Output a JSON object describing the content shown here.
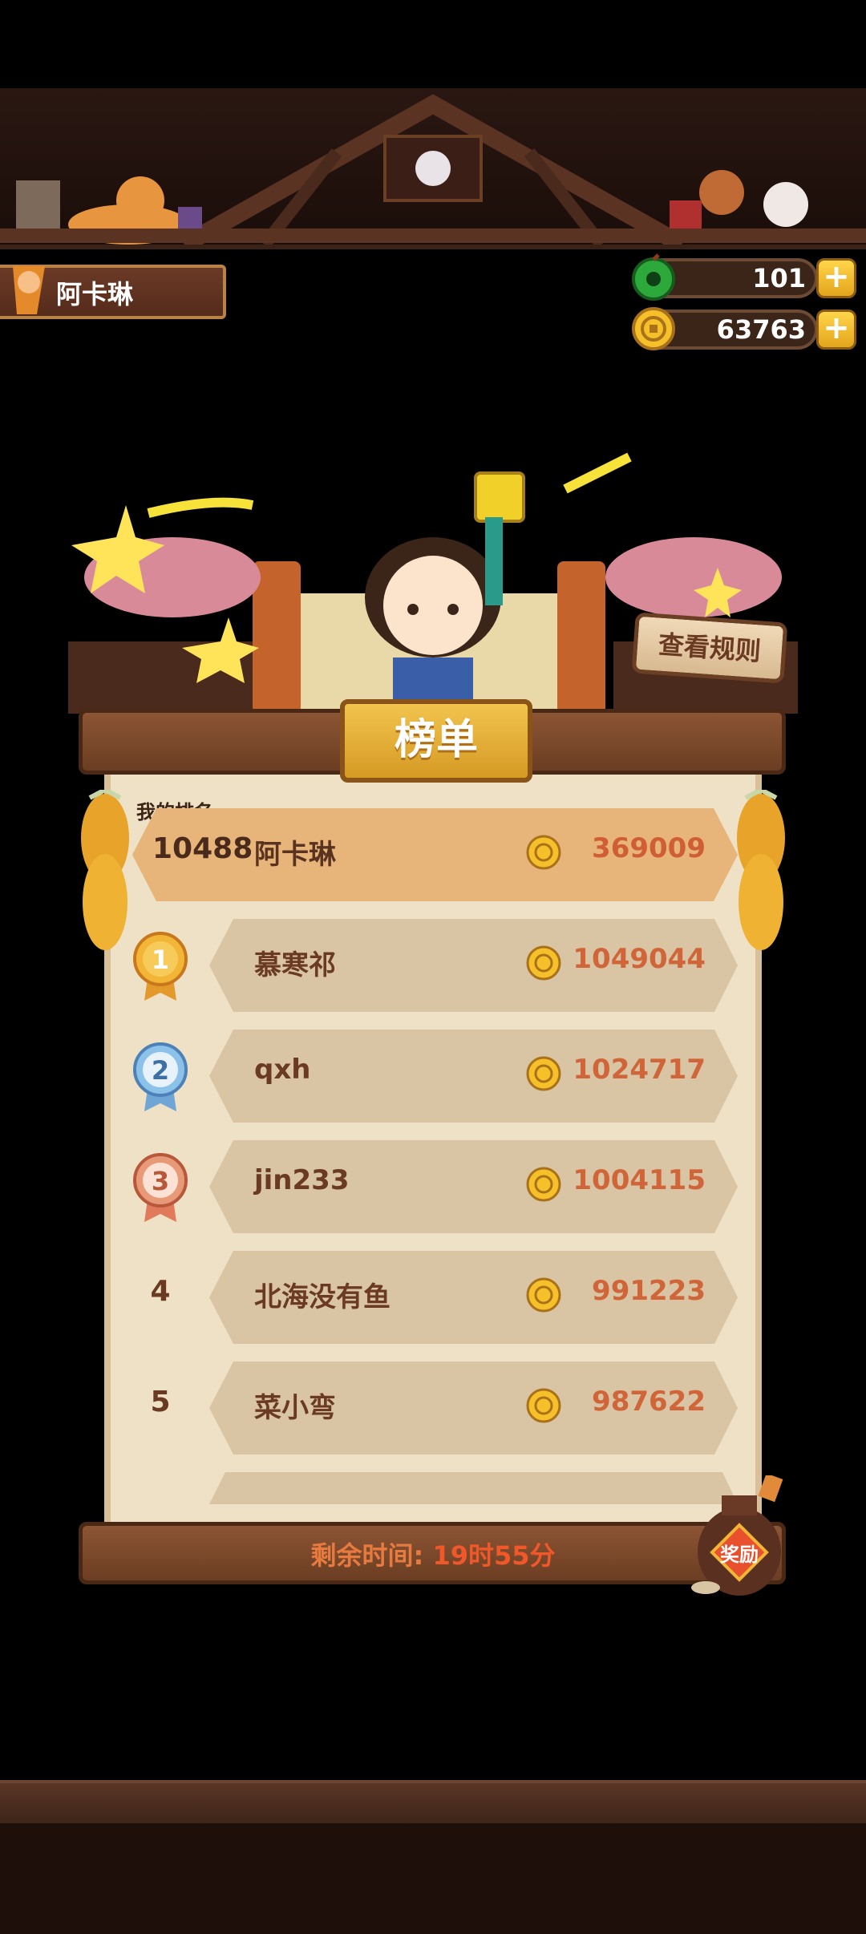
{
  "player": {
    "name": "阿卡琳"
  },
  "currency": {
    "gems": "101",
    "coins": "63763"
  },
  "rules_button": "查看规则",
  "board": {
    "title": "榜单",
    "my_rank_label": "我的排名",
    "my_rank": {
      "rank": "10488",
      "name": "阿卡琳",
      "score": "369009"
    },
    "entries": [
      {
        "rank": "1",
        "name": "慕寒祁",
        "score": "1049044",
        "medal": "gold"
      },
      {
        "rank": "2",
        "name": "qxh",
        "score": "1024717",
        "medal": "silver"
      },
      {
        "rank": "3",
        "name": "jin233",
        "score": "1004115",
        "medal": "bronze"
      },
      {
        "rank": "4",
        "name": "北海没有鱼",
        "score": "991223"
      },
      {
        "rank": "5",
        "name": "菜小弯",
        "score": "987622"
      }
    ],
    "timer_label": "剩余时间: ",
    "timer_value": "19时55分",
    "reward_label": "奖励"
  },
  "colors": {
    "score": "#d0653a",
    "name": "#6b3a22",
    "accent_gold": "#f2c44e"
  }
}
